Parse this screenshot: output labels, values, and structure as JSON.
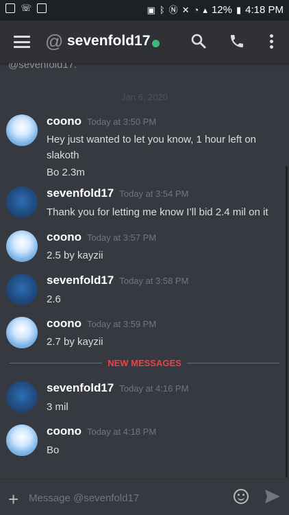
{
  "status_bar": {
    "battery": "12%",
    "time": "4:18 PM"
  },
  "header": {
    "at_symbol": "@",
    "title": "sevenfold17",
    "online_color": "#43b581"
  },
  "chat": {
    "previous_text": "@sevenfold17.",
    "date_divider": "Jan 6, 2020",
    "new_messages_label": "NEW MESSAGES",
    "messages": [
      {
        "author": "coono",
        "time": "Today at 3:50 PM",
        "lines": [
          "Hey just wanted to let you know, 1 hour left on",
          "slakoth",
          "Bo 2.3m"
        ]
      },
      {
        "author": "sevenfold17",
        "time": "Today at 3:54 PM",
        "lines": [
          "Thank you for letting me know I’ll bid 2.4 mil on it"
        ]
      },
      {
        "author": "coono",
        "time": "Today at 3:57 PM",
        "lines": [
          "2.5 by kayzii"
        ]
      },
      {
        "author": "sevenfold17",
        "time": "Today at 3:58 PM",
        "lines": [
          "2.6"
        ]
      },
      {
        "author": "coono",
        "time": "Today at 3:59 PM",
        "lines": [
          "2.7 by kayzii"
        ]
      },
      {
        "author": "sevenfold17",
        "time": "Today at 4:16 PM",
        "lines": [
          "3 mil"
        ]
      },
      {
        "author": "coono",
        "time": "Today at 4:18 PM",
        "lines": [
          "Bo"
        ]
      }
    ]
  },
  "input": {
    "placeholder": "Message @sevenfold17"
  },
  "colors": {
    "accent_red": "#ed4245",
    "background": "#36393f",
    "header_bg": "#2f3136"
  }
}
